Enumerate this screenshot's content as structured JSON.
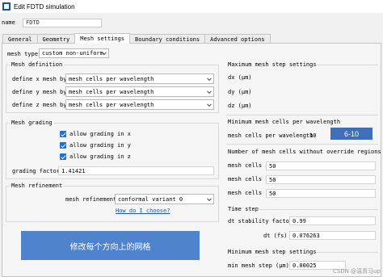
{
  "window": {
    "title": "Edit FDTD simulation"
  },
  "name": {
    "label": "name",
    "value": "FDTD"
  },
  "tabs": [
    "General",
    "Geometry",
    "Mesh settings",
    "Boundary conditions",
    "Advanced options"
  ],
  "mesh_type": {
    "label": "mesh type",
    "value": "custom non-uniform"
  },
  "mesh_definition": {
    "title": "Mesh definition",
    "rows": [
      {
        "label": "define x mesh by",
        "value": "mesh cells per wavelength"
      },
      {
        "label": "define y mesh by",
        "value": "mesh cells per wavelength"
      },
      {
        "label": "define z mesh by",
        "value": "mesh cells per wavelength"
      }
    ]
  },
  "mesh_grading": {
    "title": "Mesh grading",
    "checks": [
      "allow grading in x",
      "allow grading in y",
      "allow grading in z"
    ],
    "factor_label": "grading factor",
    "factor_value": "1.41421"
  },
  "mesh_refinement": {
    "title": "Mesh refinement",
    "label": "mesh refinement",
    "value": "conformal variant 0",
    "link": "How do I choose?"
  },
  "max_step": {
    "title": "Maximum mesh step settings",
    "dx": "dx (μm)",
    "dy": "dy (μm)",
    "dz": "dz (μm)"
  },
  "min_cells": {
    "title": "Minimum mesh cells per wavelength",
    "label": "mesh cells per wavelength",
    "value": "10"
  },
  "cells": {
    "title": "Number of mesh cells without override regions",
    "rows": [
      {
        "label": "mesh cells x",
        "value": "50"
      },
      {
        "label": "mesh cells y",
        "value": "50"
      },
      {
        "label": "mesh cells z",
        "value": "50"
      }
    ]
  },
  "time_step": {
    "title": "Time step",
    "stability_label": "dt stability factor",
    "stability_value": "0.99",
    "dt_label": "dt (fs)",
    "dt_value": "0.076263"
  },
  "min_step": {
    "title": "Minimum mesh step settings",
    "label": "min mesh step (μm)",
    "value": "0.00025"
  },
  "overlays": {
    "annotation": "修改每个方向上的网格",
    "badge": "6-10",
    "watermark": "CSDN @温青马up"
  }
}
